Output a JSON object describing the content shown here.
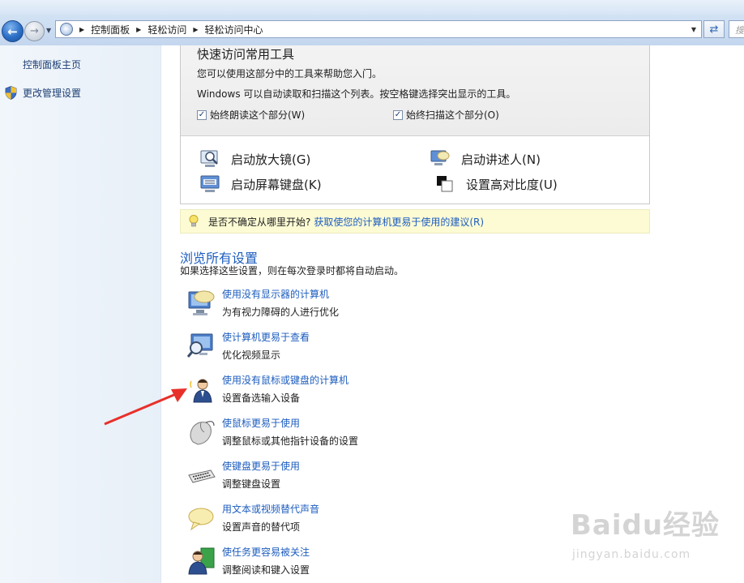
{
  "address_bar": {
    "breadcrumbs": [
      "控制面板",
      "轻松访问",
      "轻松访问中心"
    ],
    "search_placeholder": "搜"
  },
  "left_pane": {
    "items": [
      {
        "label": "控制面板主页"
      },
      {
        "label": "更改管理设置",
        "icon": "shield-icon"
      }
    ]
  },
  "quick_access": {
    "title": "快速访问常用工具",
    "line1": "您可以使用这部分中的工具来帮助您入门。",
    "line2": "Windows 可以自动读取和扫描这个列表。按空格键选择突出显示的工具。",
    "checkbox_read": {
      "label": "始终朗读这个部分(W)",
      "checked": true
    },
    "checkbox_scan": {
      "label": "始终扫描这个部分(O)",
      "checked": true
    },
    "tools": [
      {
        "label": "启动放大镜(G)",
        "icon": "magnifier-icon"
      },
      {
        "label": "启动讲述人(N)",
        "icon": "narrator-icon"
      },
      {
        "label": "启动屏幕键盘(K)",
        "icon": "on-screen-keyboard-icon"
      },
      {
        "label": "设置高对比度(U)",
        "icon": "high-contrast-icon"
      }
    ]
  },
  "tip": {
    "text": "是否不确定从哪里开始?",
    "link": "获取使您的计算机更易于使用的建议(R)"
  },
  "browse": {
    "title": "浏览所有设置",
    "subtitle": "如果选择这些设置，则在每次登录时都将自动启动。",
    "items": [
      {
        "title": "使用没有显示器的计算机",
        "desc": "为有视力障碍的人进行优化",
        "icon": "no-display-icon"
      },
      {
        "title": "使计算机更易于查看",
        "desc": "优化视频显示",
        "icon": "magnify-display-icon"
      },
      {
        "title": "使用没有鼠标或键盘的计算机",
        "desc": "设置备选输入设备",
        "icon": "user-speech-icon"
      },
      {
        "title": "使鼠标更易于使用",
        "desc": "调整鼠标或其他指针设备的设置",
        "icon": "mouse-icon"
      },
      {
        "title": "使键盘更易于使用",
        "desc": "调整键盘设置",
        "icon": "keyboard-icon"
      },
      {
        "title": "用文本或视频替代声音",
        "desc": "设置声音的替代项",
        "icon": "speech-bubble-icon"
      },
      {
        "title": "使任务更容易被关注",
        "desc": "调整阅读和键入设置",
        "icon": "focus-user-icon"
      }
    ]
  },
  "watermark": {
    "logo": "Baidu经验",
    "url": "jingyan.baidu.com"
  },
  "colors": {
    "link": "#1d5dbf",
    "tip_background": "#fcfbd4",
    "annotation_arrow": "#e8302a"
  }
}
